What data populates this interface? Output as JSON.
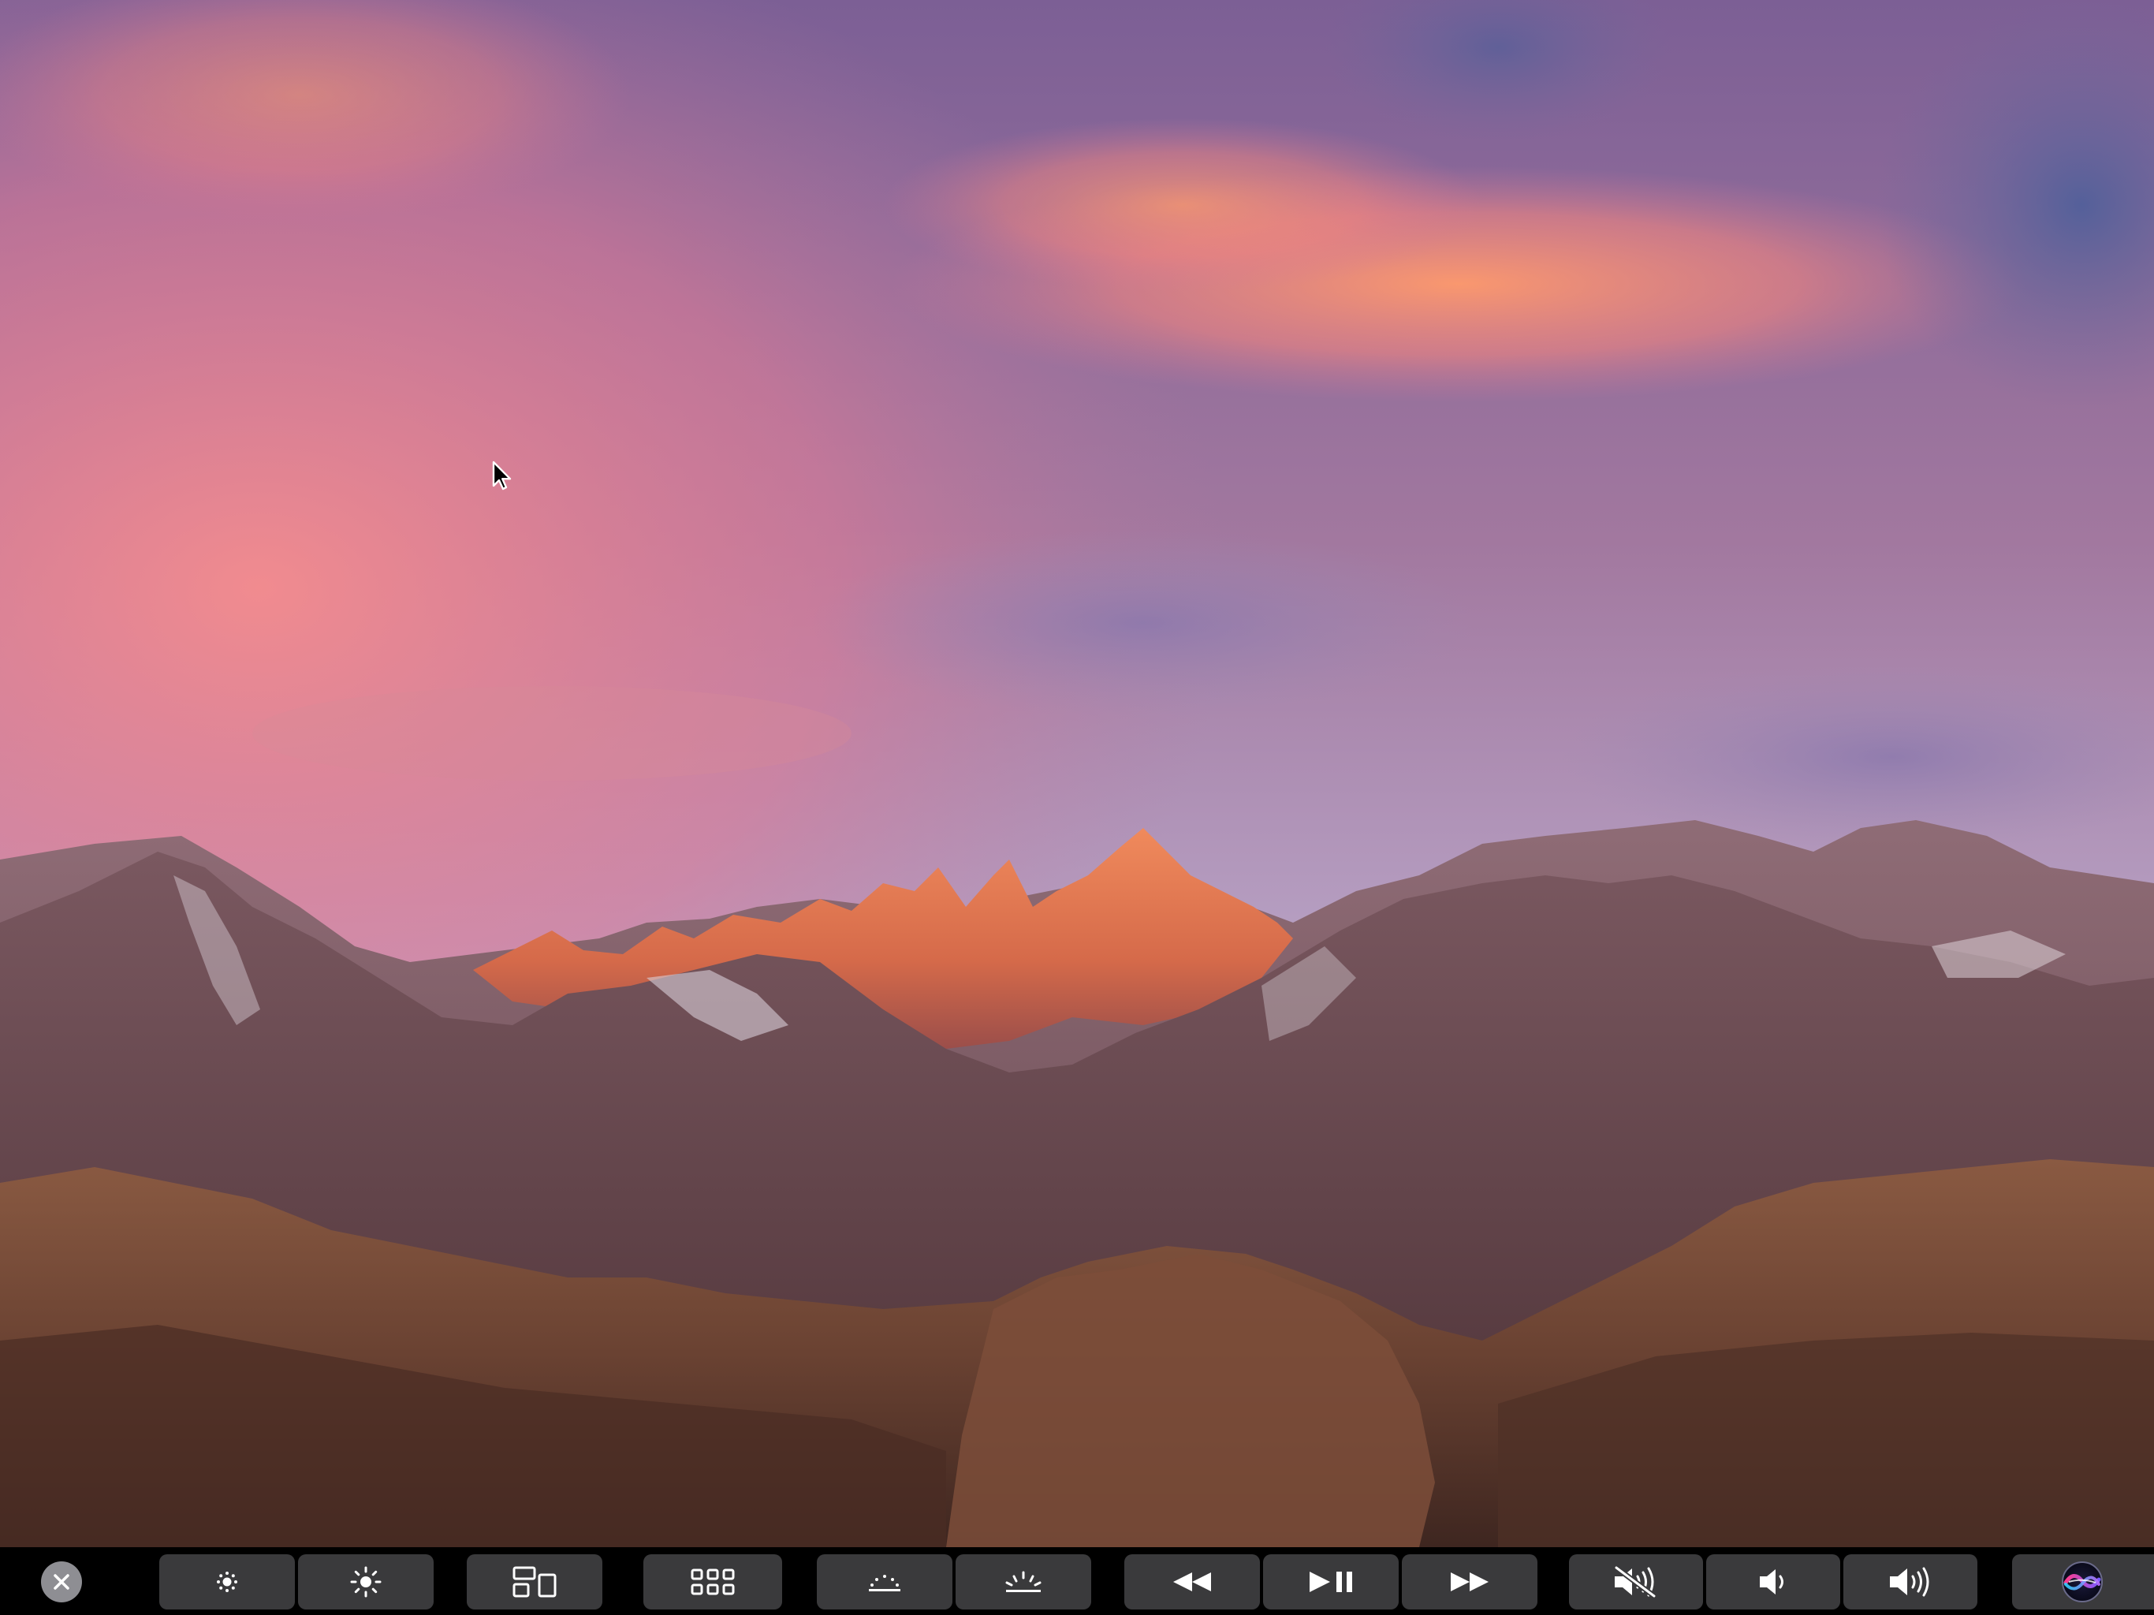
{
  "desktop": {
    "wallpaper": "macos-sierra-mountain-sunset",
    "cursor_icon": "arrow-pointer-icon"
  },
  "touchbar": {
    "close": {
      "icon": "close-icon"
    },
    "buttons": [
      {
        "name": "brightness-down",
        "icon": "brightness-down-icon"
      },
      {
        "name": "brightness-up",
        "icon": "brightness-up-icon"
      },
      {
        "name": "mission-control",
        "icon": "mission-control-icon"
      },
      {
        "name": "launchpad",
        "icon": "launchpad-icon"
      },
      {
        "name": "keyboard-brightness-down",
        "icon": "keyboard-brightness-down-icon"
      },
      {
        "name": "keyboard-brightness-up",
        "icon": "keyboard-brightness-up-icon"
      },
      {
        "name": "rewind",
        "icon": "rewind-icon"
      },
      {
        "name": "play-pause",
        "icon": "play-pause-icon"
      },
      {
        "name": "fast-forward",
        "icon": "fast-forward-icon"
      },
      {
        "name": "mute",
        "icon": "mute-icon"
      },
      {
        "name": "volume-down",
        "icon": "volume-down-icon"
      },
      {
        "name": "volume-up",
        "icon": "volume-up-icon"
      }
    ],
    "siri": {
      "icon": "siri-icon"
    }
  },
  "colors": {
    "touchbar_bg": "#000000",
    "button_bg": "#3a3a3c",
    "icon": "#ffffff"
  }
}
